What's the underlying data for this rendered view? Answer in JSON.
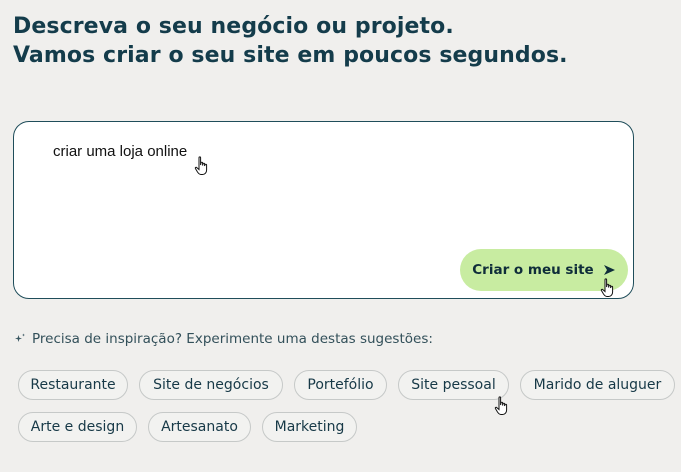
{
  "heading": {
    "line1": "Descreva o seu negócio ou projeto.",
    "line2": "Vamos criar o seu site em poucos segundos."
  },
  "prompt": {
    "value": "criar uma loja online",
    "submit_label": "Criar o meu site",
    "submit_icon": "arrow-right-icon"
  },
  "hint": {
    "icon": "sparkle-icon",
    "text": "Precisa de inspiração? Experimente uma destas sugestões:"
  },
  "suggestions": [
    "Restaurante",
    "Site de negócios",
    "Portefólio",
    "Site pessoal",
    "Marido de aluguer",
    "Arte e design",
    "Artesanato",
    "Marketing"
  ],
  "colors": {
    "heading": "#143c4b",
    "button_bg": "#c8eca1",
    "box_border": "#1f4d5a",
    "page_bg": "#f0efed"
  }
}
